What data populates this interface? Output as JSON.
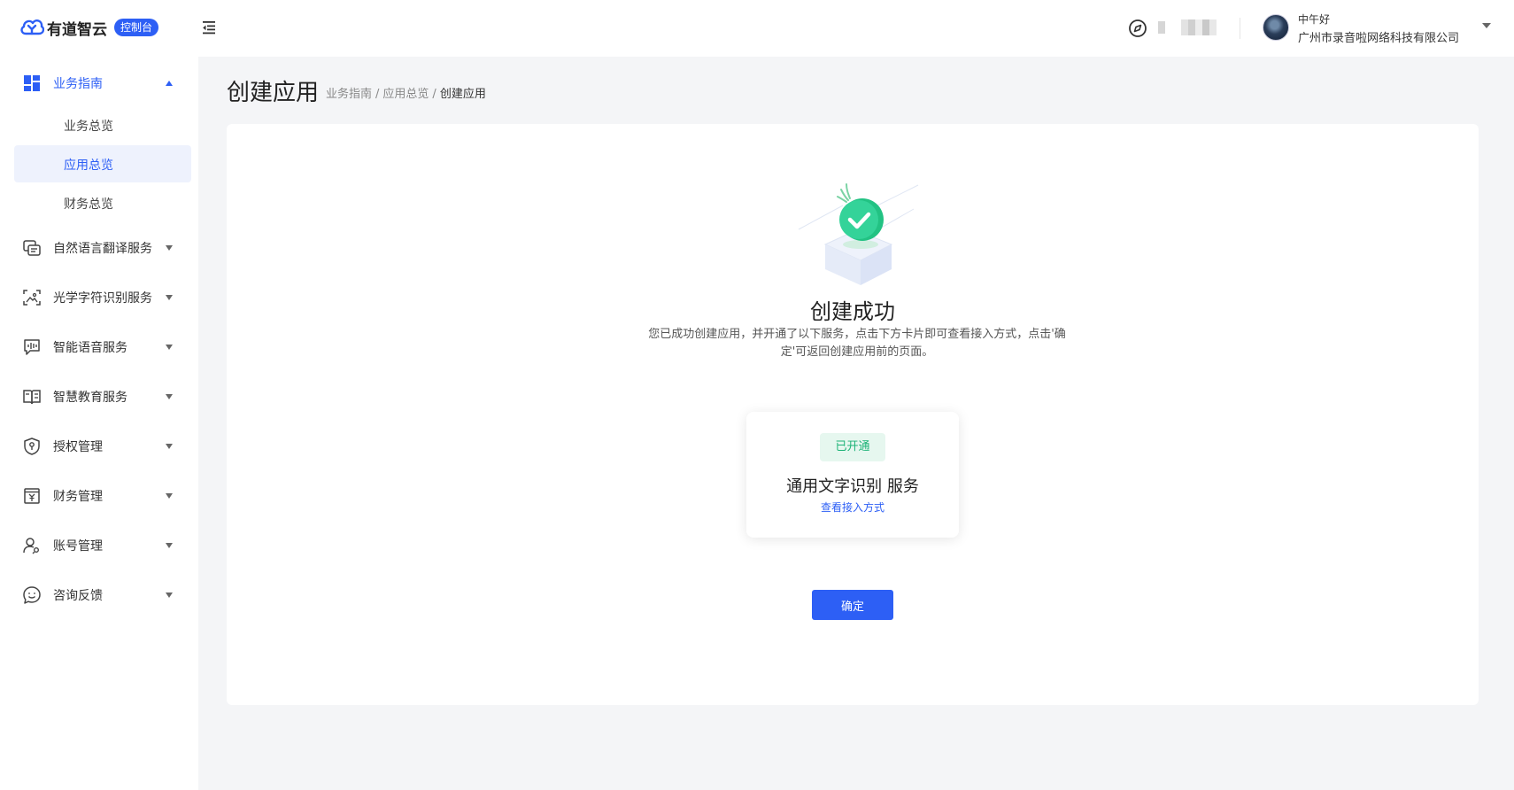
{
  "header": {
    "brand": "有道智云",
    "badge": "控制台",
    "greeting": "中午好",
    "company": "广州市录音啦网络科技有限公司"
  },
  "sidebar": {
    "groups": [
      {
        "label": "业务指南",
        "icon": "dashboard-icon",
        "expanded": true
      },
      {
        "label": "自然语言翻译服务",
        "icon": "translate-chat-icon"
      },
      {
        "label": "光学字符识别服务",
        "icon": "scan-image-icon"
      },
      {
        "label": "智能语音服务",
        "icon": "voice-wave-icon"
      },
      {
        "label": "智慧教育服务",
        "icon": "open-book-icon"
      },
      {
        "label": "授权管理",
        "icon": "shield-key-icon"
      },
      {
        "label": "财务管理",
        "icon": "finance-yen-icon"
      },
      {
        "label": "账号管理",
        "icon": "user-key-icon"
      },
      {
        "label": "咨询反馈",
        "icon": "smile-chat-icon"
      }
    ],
    "sub_items": [
      {
        "label": "业务总览"
      },
      {
        "label": "应用总览",
        "selected": true
      },
      {
        "label": "财务总览"
      }
    ]
  },
  "main": {
    "title": "创建应用",
    "breadcrumb": [
      "业务指南",
      "应用总览",
      "创建应用"
    ],
    "breadcrumb_sep": "/",
    "success_title": "创建成功",
    "success_desc": "您已成功创建应用，并开通了以下服务，点击下方卡片即可查看接入方式，点击'确定'可返回创建应用前的页面。",
    "service": {
      "status": "已开通",
      "name": "通用文字识别 服务",
      "link": "查看接入方式"
    },
    "confirm_label": "确定"
  },
  "colors": {
    "accent": "#2d5ff5",
    "success": "#1db377",
    "success_bg": "#e6f7ef",
    "page_bg": "#f4f5f7"
  }
}
